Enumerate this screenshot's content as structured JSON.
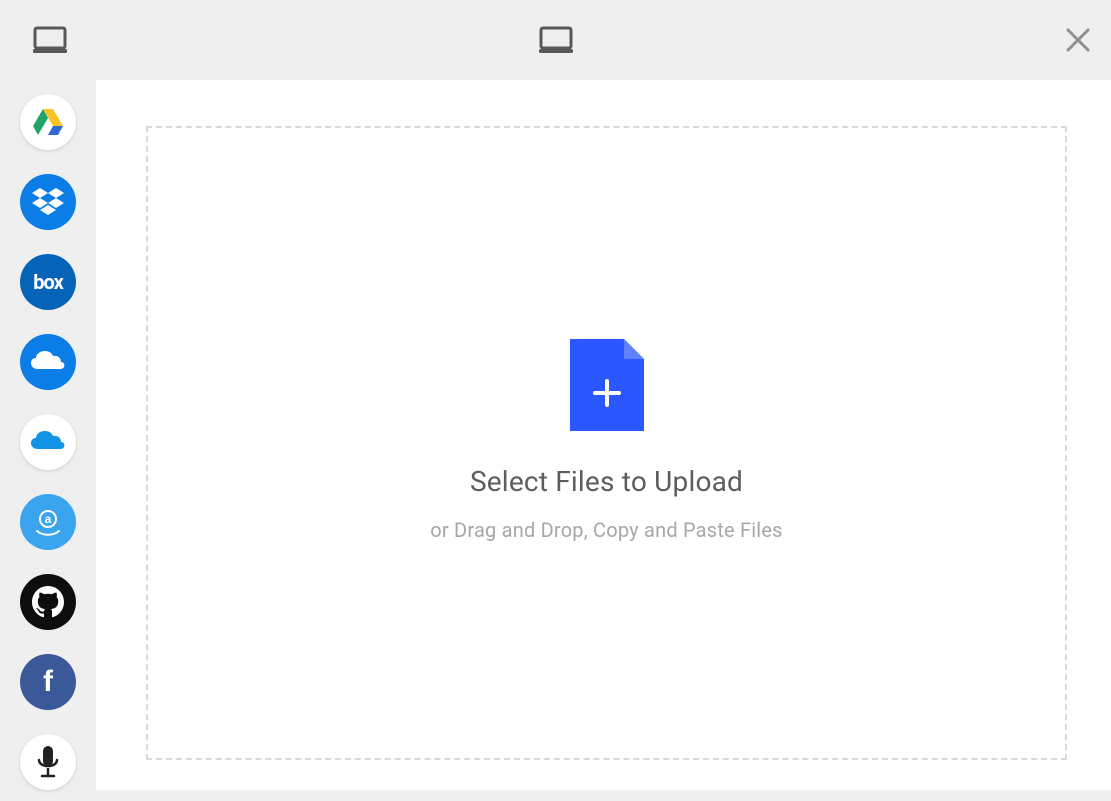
{
  "dropzone": {
    "title": "Select Files to Upload",
    "subtitle": "or Drag and Drop, Copy and Paste Files"
  },
  "sources": {
    "device_local": "My Device",
    "gdrive": "Google Drive",
    "dropbox": "Dropbox",
    "box": "Box",
    "onedrive_business": "OneDrive",
    "onedrive_personal": "OneDrive Personal",
    "amazon": "Amazon Drive",
    "github": "GitHub",
    "facebook": "Facebook",
    "audio": "Audio"
  },
  "actions": {
    "close": "Close"
  },
  "colors": {
    "accent": "#2a57ff",
    "dropbox": "#0a7ee6",
    "box": "#0664b8",
    "amazon": "#3ba4ef",
    "facebook": "#3b5998",
    "github": "#0d0d0d"
  }
}
